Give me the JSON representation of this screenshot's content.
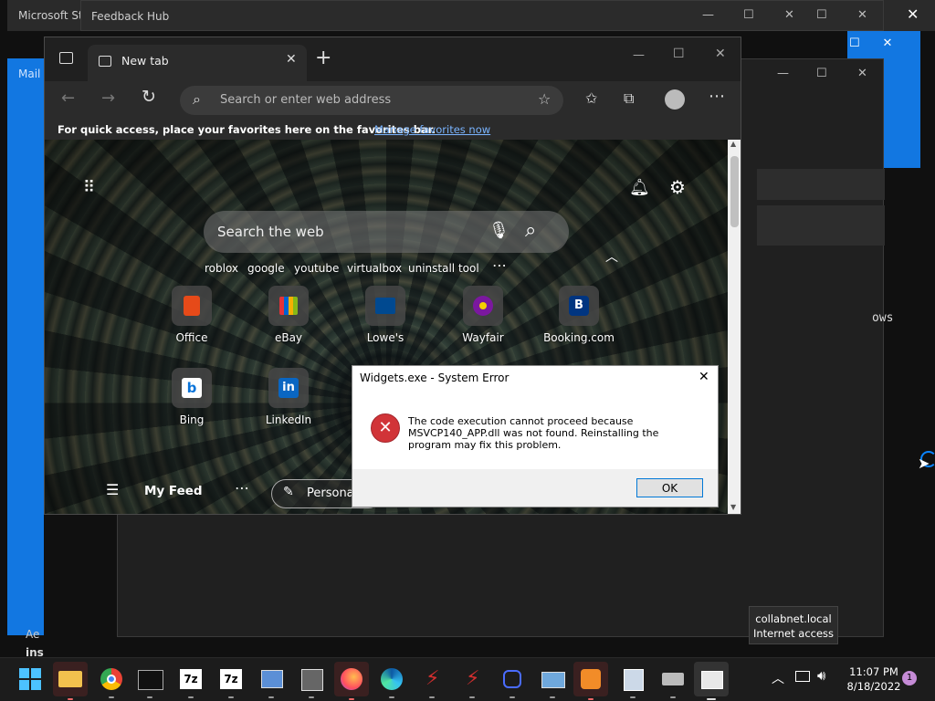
{
  "background_windows": {
    "store_title": "Microsoft Store",
    "feedback_title": "Feedback Hub",
    "mail_title": "Mail",
    "right_fragment": "ows",
    "left_fragment_a": "Ae",
    "left_fragment_b": "ins"
  },
  "browser": {
    "tab_label": "New tab",
    "address_placeholder": "Search or enter web address",
    "favorites_hint": "For quick access, place your favorites here on the favorites bar.",
    "manage_favorites_link": "Manage favorites now",
    "ntp": {
      "search_placeholder": "Search the web",
      "suggestions": [
        "roblox",
        "google",
        "youtube",
        "virtualbox",
        "uninstall tool"
      ],
      "quick_links": [
        {
          "label": "Office",
          "icon": "office-icon"
        },
        {
          "label": "eBay",
          "icon": "ebay-icon"
        },
        {
          "label": "Lowe's",
          "icon": "lowes-icon"
        },
        {
          "label": "Wayfair",
          "icon": "wayfair-icon"
        },
        {
          "label": "Booking.com",
          "icon": "booking-icon"
        },
        {
          "label": "Bing",
          "icon": "bing-icon"
        },
        {
          "label": "LinkedIn",
          "icon": "linkedin-icon"
        }
      ],
      "feed_label": "My Feed",
      "personalize_label": "Personalize"
    }
  },
  "dialog": {
    "title": "Widgets.exe - System Error",
    "message": "The code execution cannot proceed because MSVCP140_APP.dll was not found. Reinstalling the program may fix this problem.",
    "ok_label": "OK"
  },
  "tooltip": {
    "line1": "collabnet.local",
    "line2": "Internet access"
  },
  "taskbar": {
    "time": "11:07 PM",
    "date": "8/18/2022",
    "notification_count": "1",
    "apps": [
      "start-icon",
      "file-explorer-icon",
      "chrome-icon",
      "terminal-icon",
      "7zip-icon",
      "7zip-icon",
      "network-tool-icon",
      "tool-icon",
      "firefox-icon",
      "edge-icon",
      "filezilla-icon",
      "filezilla-icon",
      "cable-icon",
      "mail-icon",
      "media-player-icon",
      "image-icon",
      "printer-icon",
      "widgets-icon"
    ]
  },
  "colors": {
    "accent": "#0078d7",
    "error_red": "#d13438",
    "link_blue": "#7ab4ff"
  }
}
